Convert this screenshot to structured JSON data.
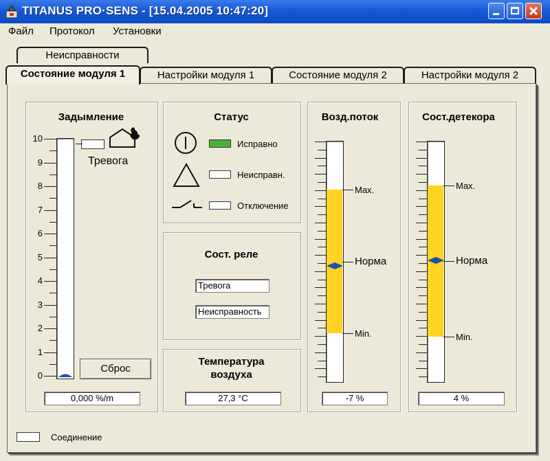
{
  "window": {
    "title": "TITANUS PRO·SENS - [15.04.2005 10:47:20]",
    "icon": "titanus-app-icon"
  },
  "menu": [
    "Файл",
    "Протокол",
    "Установки"
  ],
  "tabs": {
    "back_row": [
      "Неисправности"
    ],
    "front_row": [
      "Состояние модуля 1",
      "Настройки модуля 1",
      "Состояние модуля 2",
      "Настройки модуля 2"
    ],
    "active": "Состояние модуля 1"
  },
  "smoke": {
    "title": "Задымление",
    "scale": [
      "10",
      "9",
      "8",
      "7",
      "6",
      "5",
      "4",
      "3",
      "2",
      "1",
      "0"
    ],
    "alarm_label": "Тревога",
    "reset_button": "Сброс",
    "readout": "0,000 %/m",
    "level_fraction": 0.0
  },
  "status": {
    "title": "Статус",
    "items": [
      {
        "label": "Исправно",
        "icon": "power-icon",
        "active": true,
        "color": "#4caf3c"
      },
      {
        "label": "Неисправн.",
        "icon": "warning-triangle-icon",
        "active": false
      },
      {
        "label": "Отключение",
        "icon": "switch-off-icon",
        "active": false
      }
    ]
  },
  "relays": {
    "title": "Сост. реле",
    "fields": [
      "Тревога",
      "Неисправность"
    ]
  },
  "temperature": {
    "title_line1": "Температура",
    "title_line2": "воздуха",
    "value": "27,3 °C"
  },
  "airflow": {
    "title": "Возд.поток",
    "max_label": "Max.",
    "norm_label": "Норма",
    "min_label": "Min.",
    "readout": "-7 %"
  },
  "detector": {
    "title": "Сост.детекора",
    "max_label": "Max.",
    "norm_label": "Норма",
    "min_label": "Min.",
    "readout": "4 %"
  },
  "connection": {
    "label": "Соединение"
  },
  "colors": {
    "titlebar": "#1559d6",
    "gauge_band": "#ffd321",
    "marker": "#1f4fa8",
    "ok_indicator": "#4caf3c"
  }
}
